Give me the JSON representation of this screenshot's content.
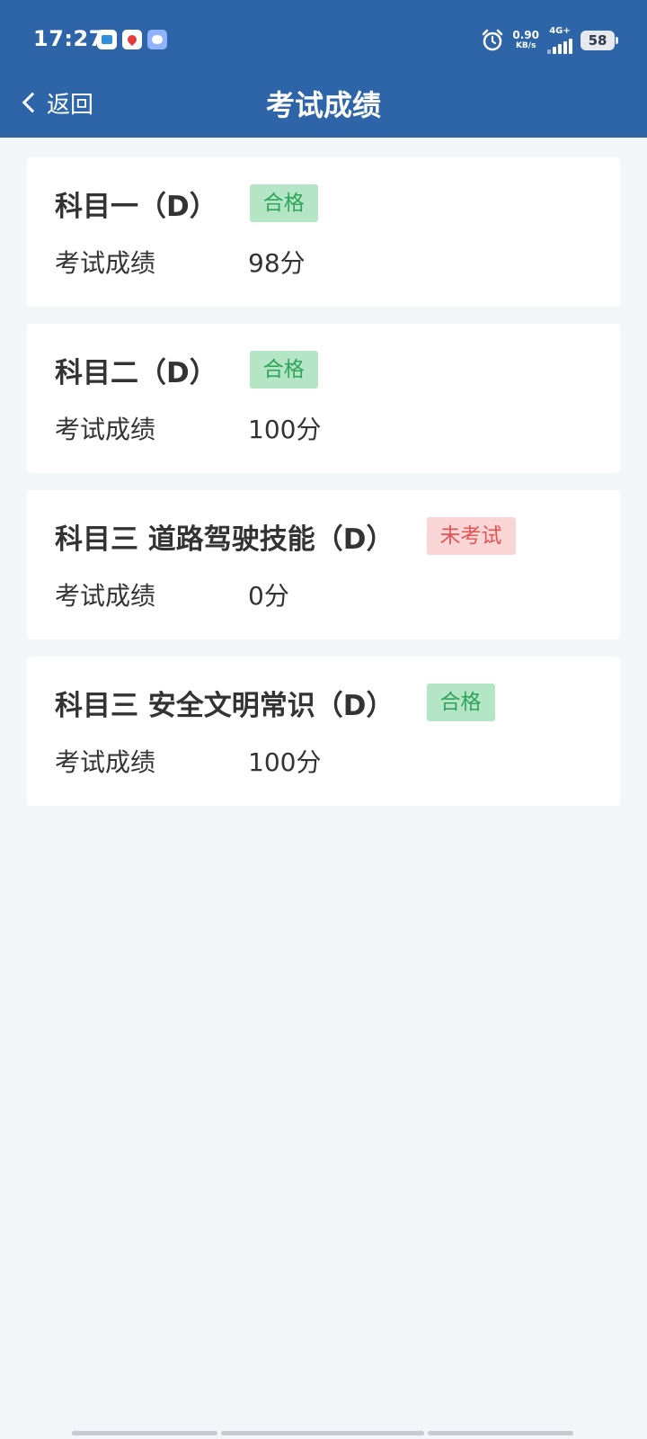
{
  "status_bar": {
    "time": "17:27",
    "net_speed_value": "0.90",
    "net_speed_unit": "KB/s",
    "network_type": "4G+",
    "battery": "58",
    "app_icons": [
      "window-app-icon",
      "maps-pin-icon",
      "cloud-app-icon"
    ]
  },
  "nav": {
    "back_label": "返回",
    "title": "考试成绩"
  },
  "colors": {
    "header": "#2d65a8",
    "pass_badge_bg": "#b4e6c6",
    "pass_badge_text": "#2fa35a",
    "fail_badge_bg": "#fad5d5",
    "fail_badge_text": "#e05555"
  },
  "subjects": [
    {
      "name": "科目一（D）",
      "status": "合格",
      "status_type": "pass",
      "score_label": "考试成绩",
      "score": "98分"
    },
    {
      "name": "科目二（D）",
      "status": "合格",
      "status_type": "pass",
      "score_label": "考试成绩",
      "score": "100分"
    },
    {
      "name": "科目三 道路驾驶技能（D）",
      "status": "未考试",
      "status_type": "fail",
      "score_label": "考试成绩",
      "score": "0分"
    },
    {
      "name": "科目三 安全文明常识（D）",
      "status": "合格",
      "status_type": "pass",
      "score_label": "考试成绩",
      "score": "100分"
    }
  ]
}
